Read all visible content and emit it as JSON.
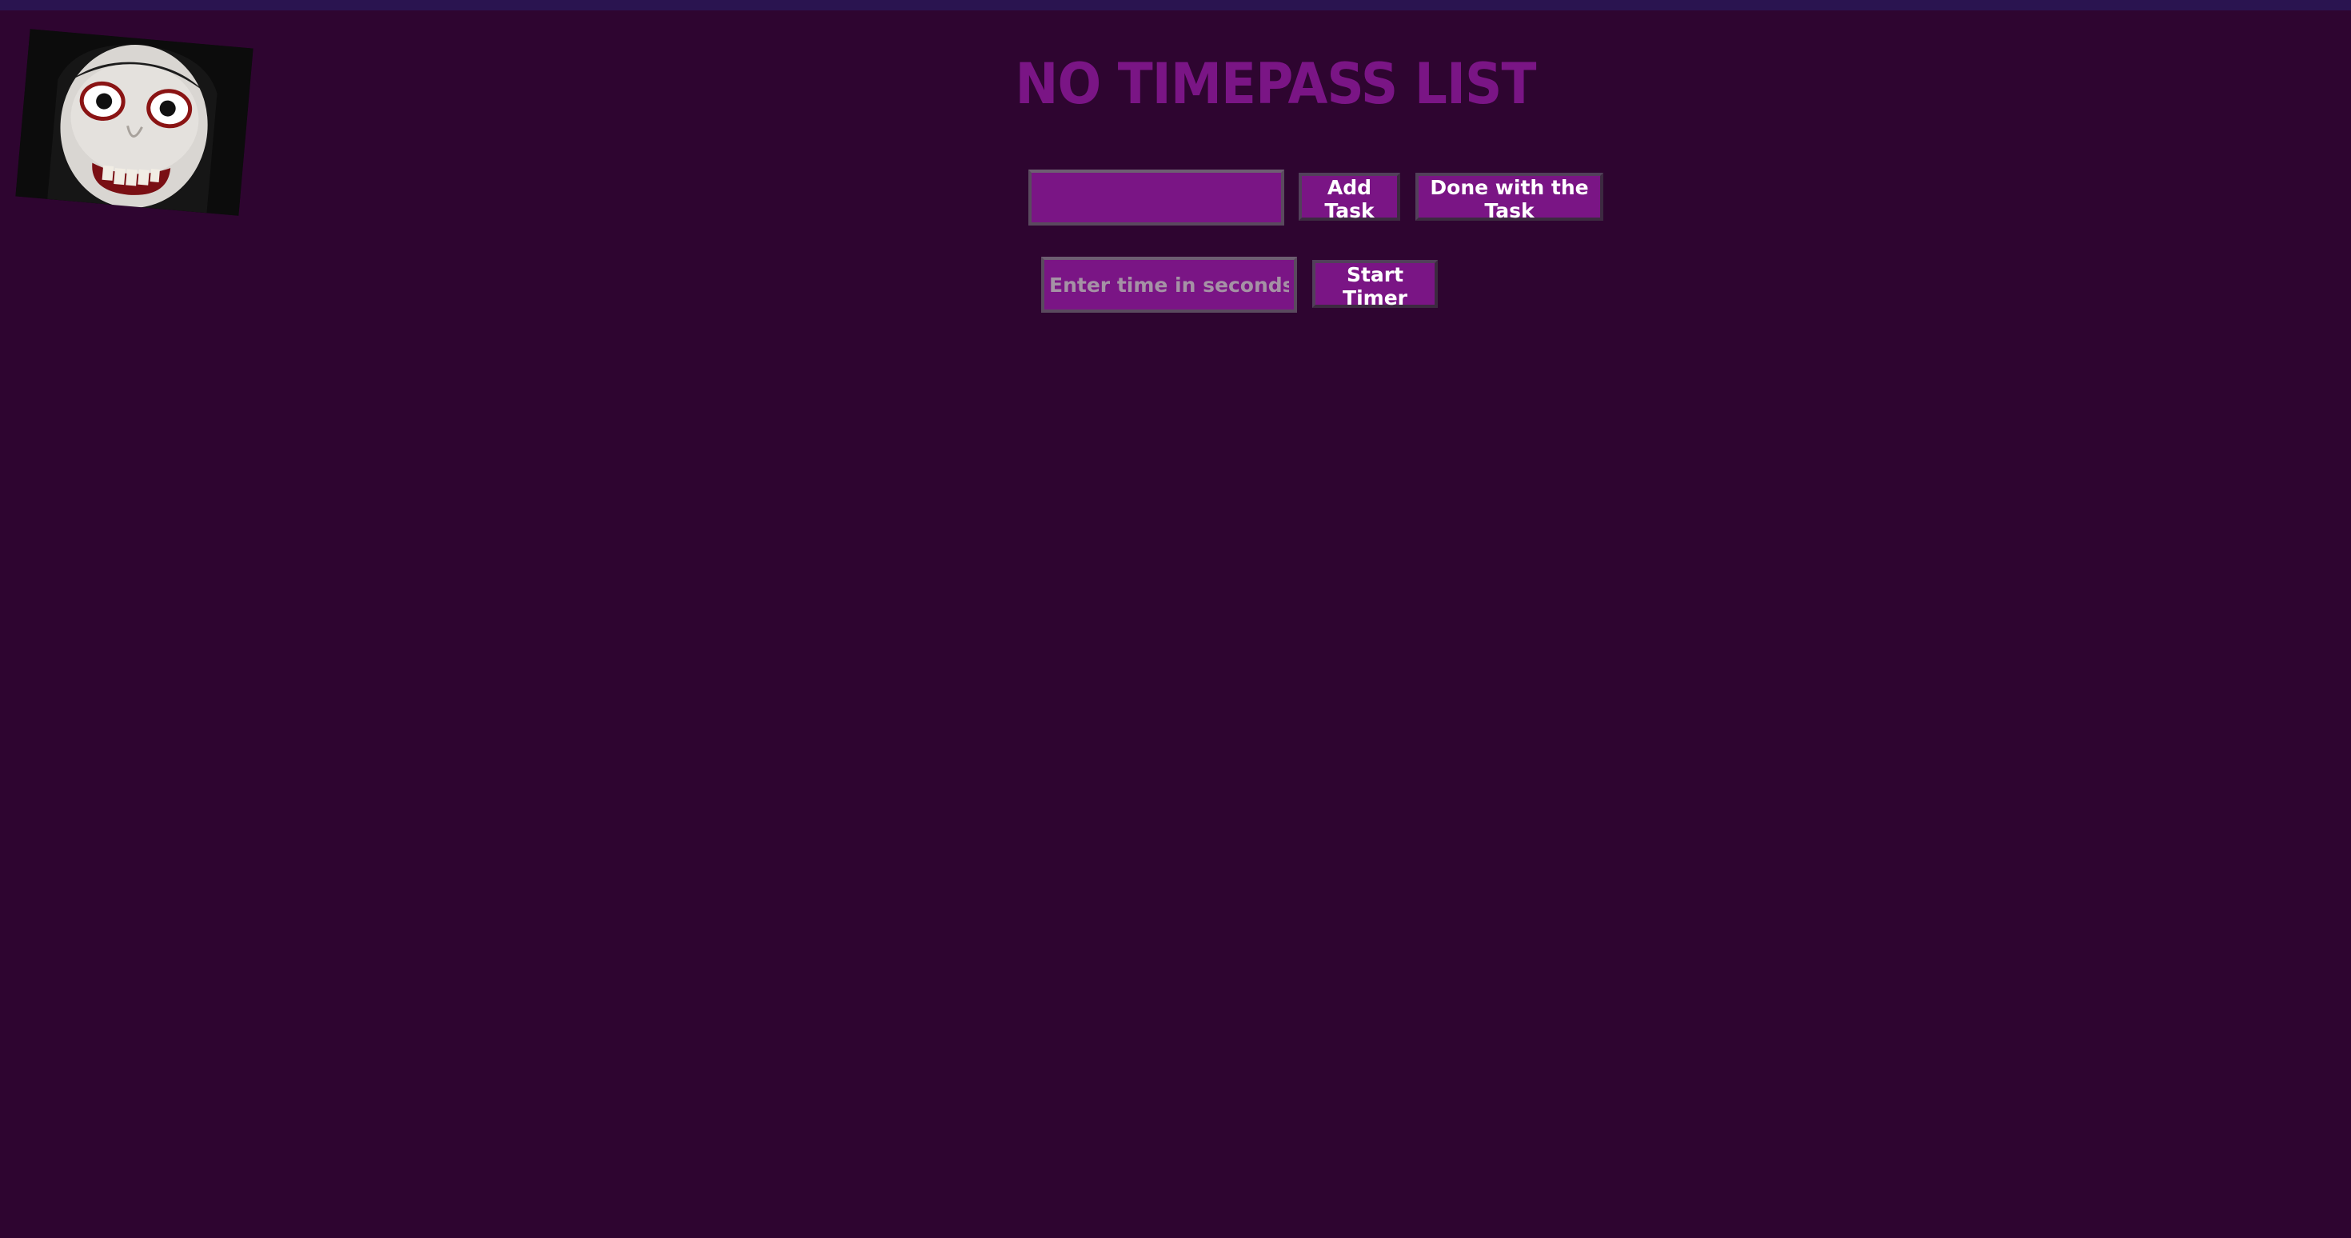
{
  "page": {
    "title": "NO TIMEPASS LIST"
  },
  "task_form": {
    "task_value": "",
    "add_label": "Add Task",
    "done_label": "Done with the Task"
  },
  "timer_form": {
    "time_value": "",
    "time_placeholder": "Enter time in seconds",
    "start_label": "Start Timer"
  },
  "colors": {
    "background": "#2e0530",
    "accent": "#7a1585",
    "button_text": "#ffffff"
  }
}
